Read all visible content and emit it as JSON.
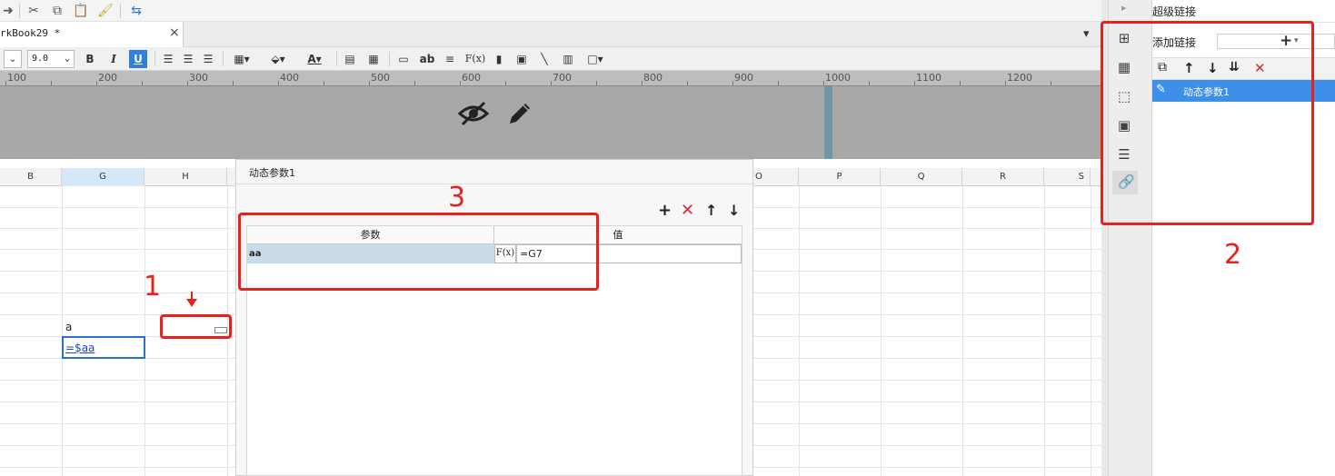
{
  "window": {
    "tab_title": "rkBook29 *",
    "tab_close": "×"
  },
  "toolbar": {
    "font_size": "9.0",
    "bold": "B",
    "italic": "I",
    "underline": "U",
    "text_ab": "ab",
    "formula": "F(x)"
  },
  "ruler": {
    "labels": [
      "100",
      "200",
      "300",
      "400",
      "500",
      "600",
      "700",
      "800",
      "900",
      "1000",
      "1100",
      "1200"
    ]
  },
  "columns": {
    "left": [
      "B",
      "G",
      "H"
    ],
    "right": [
      "O",
      "P",
      "Q",
      "R",
      "S"
    ]
  },
  "cells": {
    "g_row7": "a",
    "g_row8": "=$aa"
  },
  "dialog": {
    "title": "动态参数1",
    "col_param": "参数",
    "col_value": "值",
    "row_param": "aa",
    "row_formula_btn": "F(x)",
    "row_value": "=G7"
  },
  "right_panel": {
    "title": "超级链接",
    "add_link_label": "添加链接",
    "add_icon": "+",
    "list_item": "动态参数1"
  },
  "annotations": {
    "label_1": "1",
    "label_2": "2",
    "label_3": "3"
  },
  "colors": {
    "annotation": "#e8211c",
    "selected_item_bg": "#3d8fe8",
    "param_cell_bg": "#c9dae9",
    "active_cell_border": "#2b6fd1"
  }
}
